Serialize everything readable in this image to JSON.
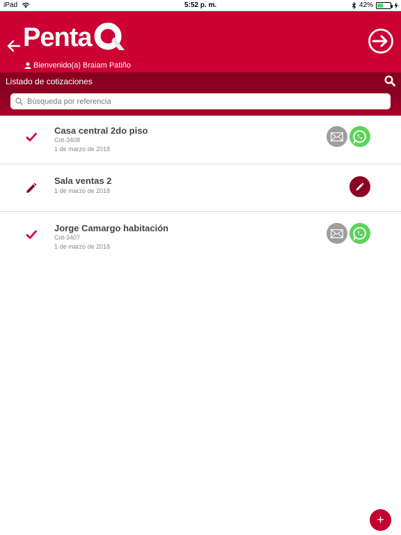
{
  "status_bar": {
    "device": "iPad",
    "time": "5:52 p. m.",
    "battery": "42%",
    "battery_level": 0.42
  },
  "header": {
    "logo_text": "Penta",
    "welcome": "Bienvenido(a) Braiam Patiño",
    "brand_color": "#cc0033"
  },
  "list_bar": {
    "title": "Listado de cotizaciones",
    "search_placeholder": "Búsqueda por referencia",
    "search_value": ""
  },
  "quotes": [
    {
      "title": "Casa central 2do piso",
      "code": "Cot-3408",
      "date": "1 de marzo de 2018",
      "status": "sent"
    },
    {
      "title": "Sala ventas 2",
      "code": "",
      "date": "1 de marzo de 2018",
      "status": "draft"
    },
    {
      "title": "Jorge Camargo habitación",
      "code": "Cot-3407",
      "date": "1 de marzo de 2018",
      "status": "sent"
    }
  ],
  "fab": {
    "label": "+"
  }
}
